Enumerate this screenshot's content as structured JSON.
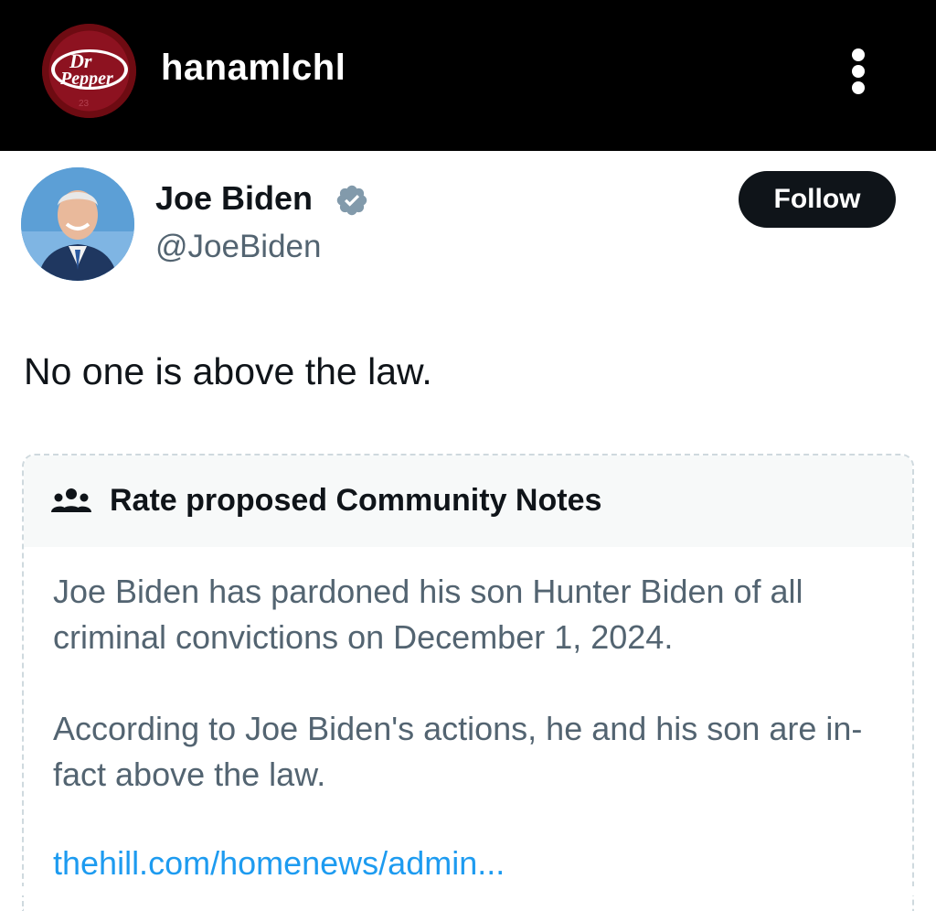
{
  "header": {
    "username": "hanamlchl",
    "avatar_label": "Dr Pepper",
    "more_icon": "more-vertical-icon"
  },
  "tweet": {
    "author_name": "Joe Biden",
    "author_handle": "@JoeBiden",
    "verified_icon": "verified-badge-icon",
    "follow_label": "Follow",
    "text": "No one is above the law."
  },
  "community_note": {
    "title": "Rate proposed Community Notes",
    "icon": "people-icon",
    "paragraph1": "Joe Biden has pardoned his son Hunter Biden of all criminal convictions on December 1, 2024.",
    "paragraph2": "According to Joe Biden's actions, he and his son are in-fact above the law.",
    "link": "thehill.com/homenews/admin..."
  },
  "colors": {
    "topbar": "#000000",
    "text_primary": "#0f1419",
    "text_secondary": "#536471",
    "link": "#1d9bf0",
    "verified": "#829aab",
    "follow_button": "#0f1419"
  }
}
